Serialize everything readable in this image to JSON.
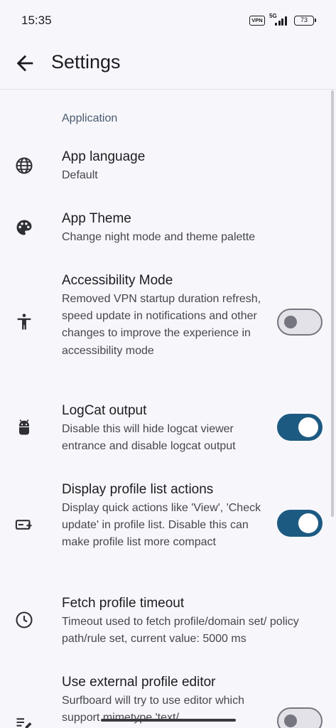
{
  "status_bar": {
    "time": "15:35",
    "vpn": "VPN",
    "network": "5G",
    "battery": "73"
  },
  "app_bar": {
    "back_icon": "arrow-back-icon",
    "title": "Settings"
  },
  "section": {
    "header": "Application"
  },
  "settings": [
    {
      "icon": "globe-icon",
      "title": "App language",
      "summary": "Default"
    },
    {
      "icon": "palette-icon",
      "title": "App Theme",
      "summary": "Change night mode and theme palette"
    },
    {
      "icon": "accessibility-icon",
      "title": "Accessibility Mode",
      "summary": "Removed VPN startup duration refresh, speed update in notifications and other changes to improve the experience in accessibility mode",
      "toggle": false
    },
    {
      "icon": "android-icon",
      "title": "LogCat output",
      "summary": "Disable this will hide logcat viewer entrance and disable logcat output",
      "toggle": true
    },
    {
      "icon": "add-to-list-icon",
      "title": "Display profile list actions",
      "summary": "Display quick actions like 'View', 'Check update' in profile list. Disable this can make profile list more compact",
      "toggle": true
    },
    {
      "icon": "clock-icon",
      "title": "Fetch profile timeout",
      "summary": "Timeout used to fetch profile/domain set/ policy path/rule set, current value: 5000 ms"
    },
    {
      "icon": "edit-note-icon",
      "title": "Use external profile editor",
      "summary": "Surfboard will try to use editor which support mimetype 'text/",
      "toggle": false
    }
  ],
  "colors": {
    "background": "#f7f7fb",
    "accent": "#1d5a82",
    "section_header": "#4a5a6f"
  }
}
